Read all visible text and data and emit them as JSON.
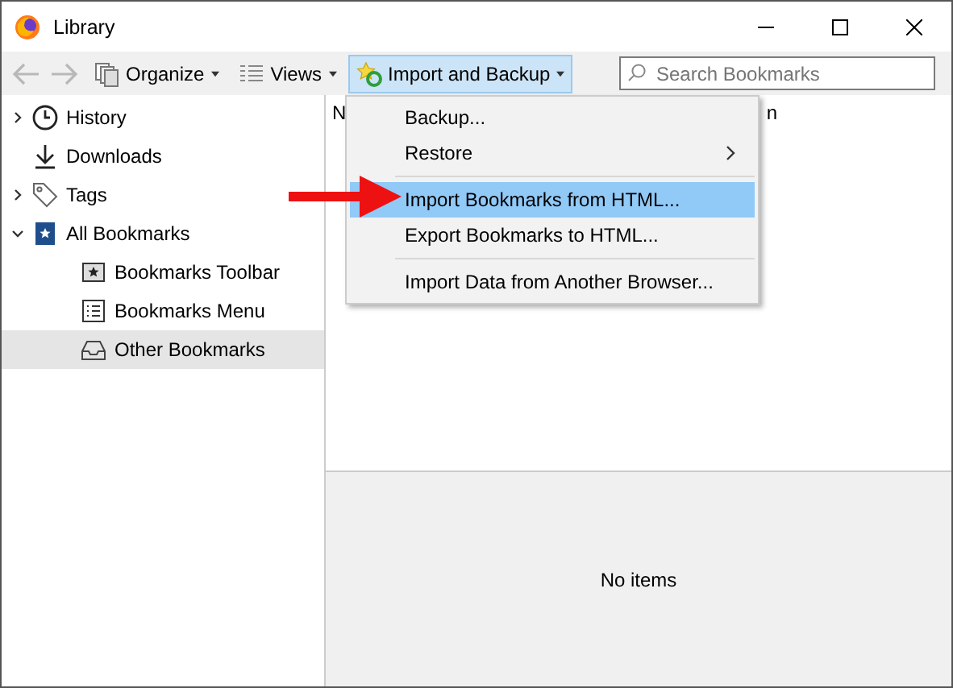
{
  "window": {
    "title": "Library"
  },
  "toolbar": {
    "organize": "Organize",
    "views": "Views",
    "import_backup": {
      "label": "Import and Backup",
      "expanded": true
    },
    "search": {
      "placeholder": "Search Bookmarks"
    }
  },
  "sidebar": {
    "items": [
      {
        "label": "History",
        "expanded": false,
        "selected": false
      },
      {
        "label": "Downloads",
        "selected": false
      },
      {
        "label": "Tags",
        "expanded": false,
        "selected": false
      },
      {
        "label": "All Bookmarks",
        "expanded": true,
        "selected": false,
        "children": [
          {
            "label": "Bookmarks Toolbar",
            "selected": false
          },
          {
            "label": "Bookmarks Menu",
            "selected": false
          },
          {
            "label": "Other Bookmarks",
            "selected": true
          }
        ]
      }
    ]
  },
  "table": {
    "columns": [
      "N",
      "n"
    ]
  },
  "details": {
    "text": "No items"
  },
  "menu": {
    "items": [
      {
        "kind": "item",
        "label": "Backup...",
        "selected": false
      },
      {
        "kind": "submenu",
        "label": "Restore",
        "selected": false
      },
      {
        "kind": "separator"
      },
      {
        "kind": "item",
        "label": "Import Bookmarks from HTML...",
        "selected": true
      },
      {
        "kind": "item",
        "label": "Export Bookmarks to HTML...",
        "selected": false
      },
      {
        "kind": "separator"
      },
      {
        "kind": "item",
        "label": "Import Data from Another Browser...",
        "selected": false
      }
    ]
  }
}
